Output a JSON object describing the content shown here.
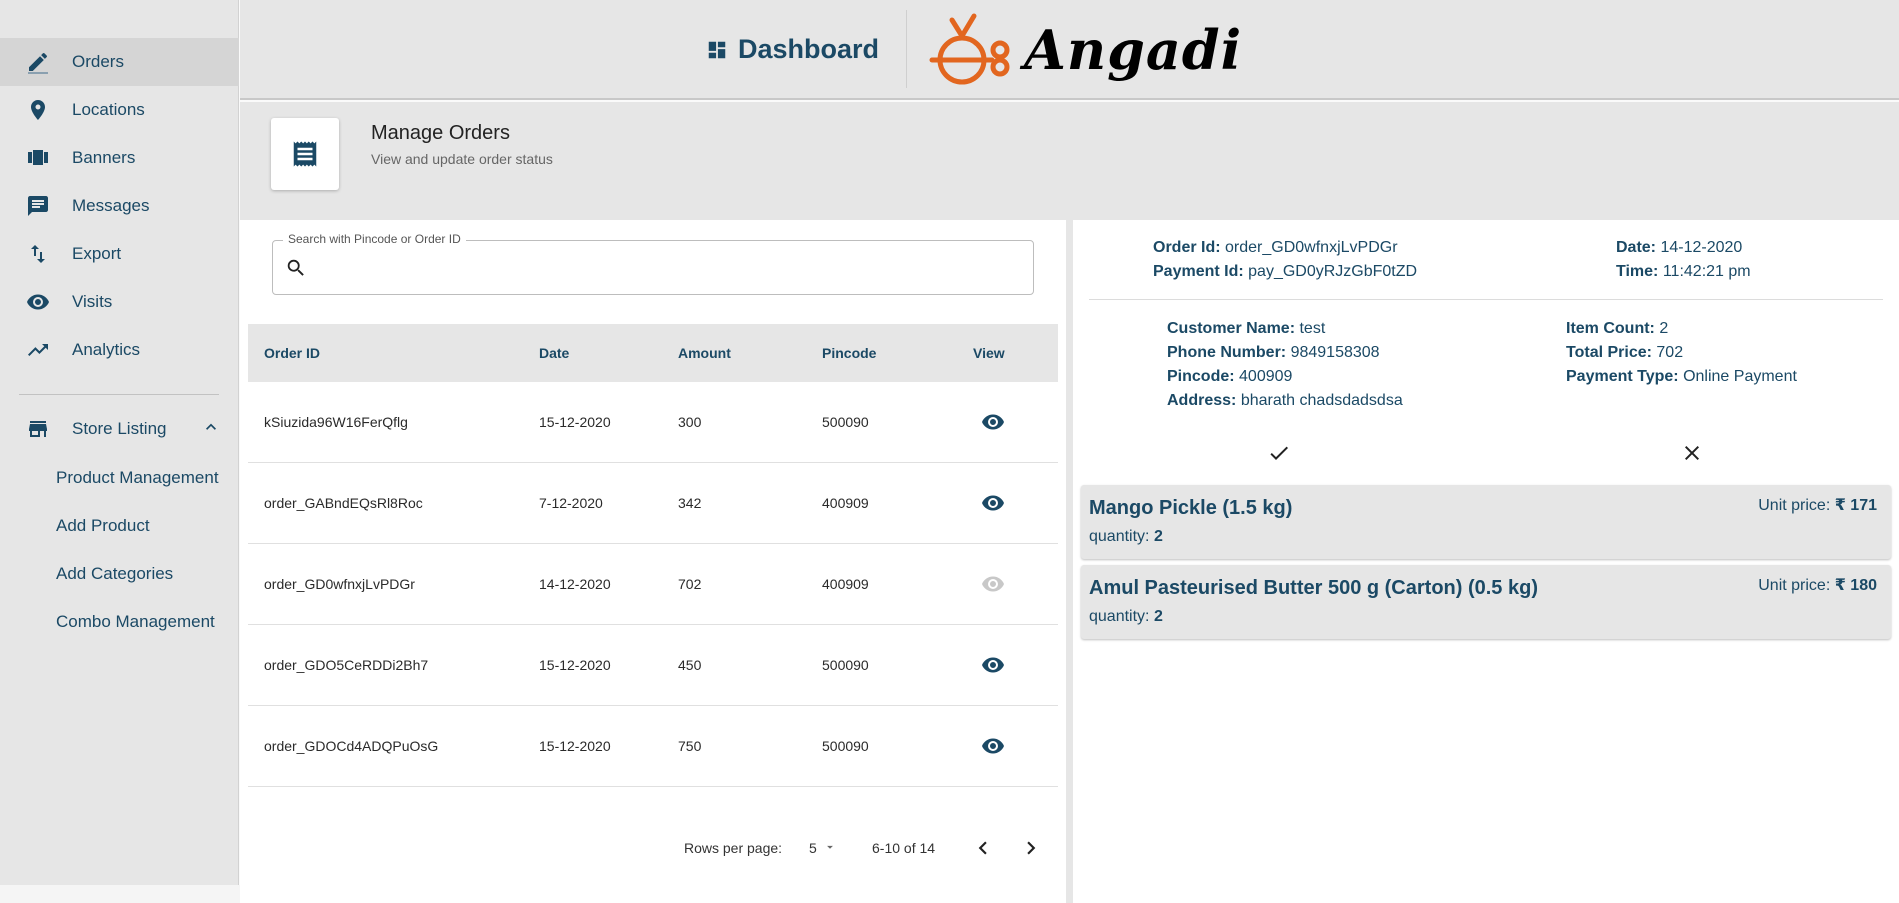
{
  "sidebar": {
    "items": [
      {
        "label": "Orders",
        "icon": "pencil-icon"
      },
      {
        "label": "Locations",
        "icon": "location-pin-icon"
      },
      {
        "label": "Banners",
        "icon": "carousel-icon"
      },
      {
        "label": "Messages",
        "icon": "chat-icon"
      },
      {
        "label": "Export",
        "icon": "import-export-icon"
      },
      {
        "label": "Visits",
        "icon": "eye-icon"
      },
      {
        "label": "Analytics",
        "icon": "trending-up-icon"
      }
    ],
    "store_listing": {
      "label": "Store Listing",
      "icon": "store-icon",
      "sub_items": [
        "Product Management",
        "Add Product",
        "Add Categories",
        "Combo Management"
      ]
    }
  },
  "header": {
    "dashboard_label": "Dashboard",
    "brand": "Angadi",
    "accent_color": "#e2661f"
  },
  "page": {
    "title": "Manage Orders",
    "subtitle": "View and update order status"
  },
  "search": {
    "label": "Search with Pincode or Order ID",
    "value": ""
  },
  "table": {
    "columns": [
      "Order ID",
      "Date",
      "Amount",
      "Pincode",
      "View"
    ],
    "rows": [
      {
        "order_id": "kSiuzida96W16FerQflg",
        "date": "15-12-2020",
        "amount": "300",
        "pincode": "500090",
        "selected": false
      },
      {
        "order_id": "order_GABndEQsRl8Roc",
        "date": "7-12-2020",
        "amount": "342",
        "pincode": "400909",
        "selected": false
      },
      {
        "order_id": "order_GD0wfnxjLvPDGr",
        "date": "14-12-2020",
        "amount": "702",
        "pincode": "400909",
        "selected": true
      },
      {
        "order_id": "order_GDO5CeRDDi2Bh7",
        "date": "15-12-2020",
        "amount": "450",
        "pincode": "500090",
        "selected": false
      },
      {
        "order_id": "order_GDOCd4ADQPuOsG",
        "date": "15-12-2020",
        "amount": "750",
        "pincode": "500090",
        "selected": false
      }
    ]
  },
  "pagination": {
    "rows_per_page_label": "Rows per page:",
    "rows_per_page": "5",
    "range": "6-10 of 14"
  },
  "order_detail": {
    "order_id_label": "Order Id:",
    "order_id": "order_GD0wfnxjLvPDGr",
    "payment_id_label": "Payment Id:",
    "payment_id": "pay_GD0yRJzGbF0tZD",
    "date_label": "Date:",
    "date": "14-12-2020",
    "time_label": "Time:",
    "time": "11:42:21 pm",
    "customer_name_label": "Customer Name:",
    "customer_name": "test",
    "phone_label": "Phone Number:",
    "phone": "9849158308",
    "pincode_label": "Pincode:",
    "pincode": "400909",
    "address_label": "Address:",
    "address": "bharath chadsdadsdsa",
    "item_count_label": "Item Count:",
    "item_count": "2",
    "total_price_label": "Total Price:",
    "total_price": "702",
    "payment_type_label": "Payment Type:",
    "payment_type": "Online Payment",
    "items": [
      {
        "name": "Mango Pickle (1.5 kg)",
        "quantity_label": "quantity:",
        "quantity": "2",
        "price_label": "Unit price:",
        "price": "₹ 171"
      },
      {
        "name": "Amul Pasteurised Butter 500 g (Carton) (0.5 kg)",
        "quantity_label": "quantity:",
        "quantity": "2",
        "price_label": "Unit price:",
        "price": "₹ 180"
      }
    ]
  }
}
